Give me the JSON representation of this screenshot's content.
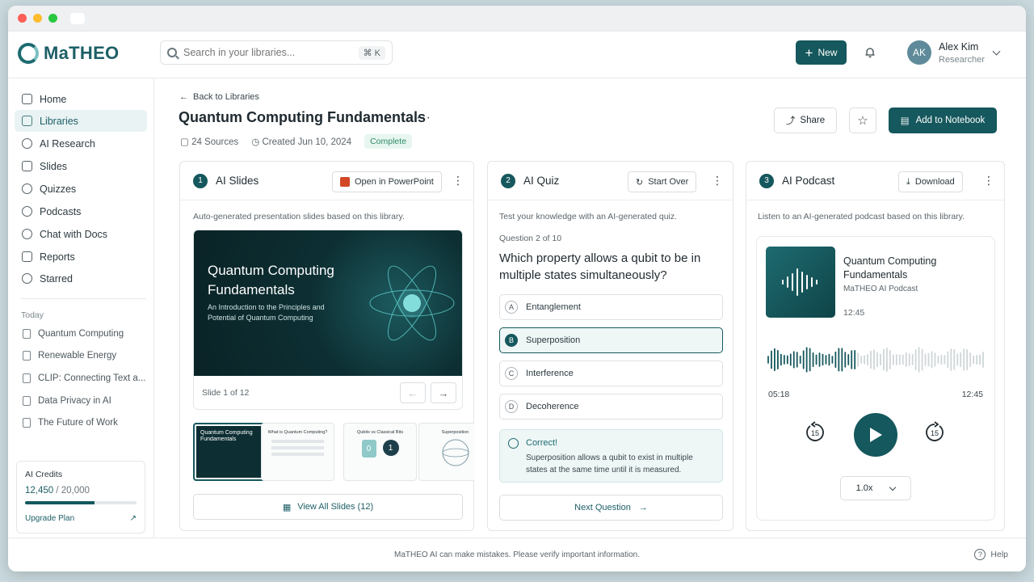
{
  "app": {
    "logo_text": "MaTHEO"
  },
  "search": {
    "placeholder": "Search in your libraries...",
    "shortcut": "⌘ K"
  },
  "header": {
    "new_label": "New",
    "user_initials": "AK",
    "user_name": "Alex Kim",
    "user_role": "Researcher"
  },
  "sidebar": {
    "items": [
      {
        "label": "Home",
        "icon": "home-icon"
      },
      {
        "label": "Libraries",
        "icon": "library-icon",
        "active": true
      },
      {
        "label": "AI Research",
        "icon": "sparkle-icon"
      },
      {
        "label": "Slides",
        "icon": "slides-icon"
      },
      {
        "label": "Quizzes",
        "icon": "quiz-icon"
      },
      {
        "label": "Podcasts",
        "icon": "podcast-icon"
      },
      {
        "label": "Chat with Docs",
        "icon": "chat-icon"
      },
      {
        "label": "Reports",
        "icon": "report-icon"
      },
      {
        "label": "Starred",
        "icon": "star-icon"
      }
    ],
    "section_label": "Today",
    "recent": [
      "Quantum Computing",
      "Renewable Energy",
      "CLIP: Connecting Text a...",
      "Data Privacy in AI",
      "The Future of Work"
    ],
    "credits": {
      "title": "AI Credits",
      "used": "12,450",
      "total": "/ 20,000",
      "progress": 0.6225,
      "upgrade_label": "Upgrade Plan"
    }
  },
  "page": {
    "back_label": "Back to Libraries",
    "title": "Quantum Computing Fundamentals",
    "sources": "24 Sources",
    "created": "Created Jun 10, 2024",
    "status": "Complete",
    "share_label": "Share",
    "notebook_label": "Add to Notebook"
  },
  "slides_card": {
    "num": "1",
    "title": "AI Slides",
    "action_label": "Open in PowerPoint",
    "description": "Auto-generated presentation slides based on this library.",
    "slide_title": "Quantum Computing Fundamentals",
    "slide_subtitle": "An Introduction to the Principles and Potential of Quantum Computing",
    "slide_counter": "Slide 1 of 12",
    "thumbs": [
      "Quantum Computing Fundamentals",
      "What is Quantum Computing?",
      "Qubits vs Classical Bits",
      "Superposition"
    ],
    "thumb_bits": [
      "0",
      "1"
    ],
    "view_all_label": "View All Slides (12)"
  },
  "quiz_card": {
    "num": "2",
    "title": "AI Quiz",
    "action_label": "Start Over",
    "description": "Test your knowledge with an AI-generated quiz.",
    "counter": "Question 2 of 10",
    "question": "Which property allows a qubit to be in multiple states simultaneously?",
    "options": [
      {
        "letter": "A",
        "text": "Entanglement"
      },
      {
        "letter": "B",
        "text": "Superposition",
        "selected": true
      },
      {
        "letter": "C",
        "text": "Interference"
      },
      {
        "letter": "D",
        "text": "Decoherence"
      }
    ],
    "feedback_title": "Correct!",
    "feedback_text": "Superposition allows a qubit to exist in multiple states at the same time until it is measured.",
    "next_label": "Next Question"
  },
  "podcast_card": {
    "num": "3",
    "title": "AI Podcast",
    "action_label": "Download",
    "description": "Listen to an AI-generated podcast based on this library.",
    "episode_title": "Quantum Computing Fundamentals",
    "episode_sub": "MaTHEO AI Podcast",
    "duration": "12:45",
    "current_time": "05:18",
    "end_time": "12:45",
    "progress": 0.416,
    "skip_back": "15",
    "skip_forward": "15",
    "speed": "1.0x"
  },
  "footer": {
    "disclaimer": "MaTHEO AI can make mistakes. Please verify important information.",
    "help_label": "Help"
  },
  "colors": {
    "accent": "#15585d",
    "success": "#2d8c6a"
  }
}
